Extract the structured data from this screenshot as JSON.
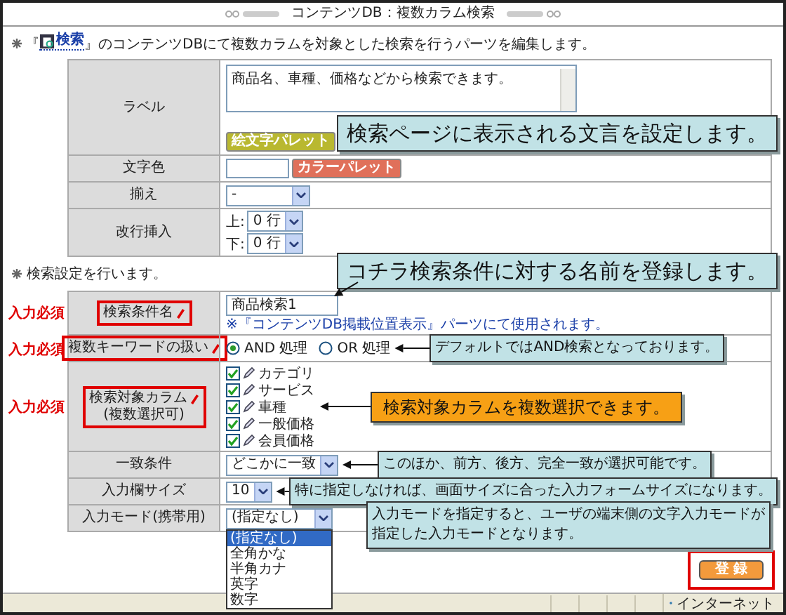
{
  "window": {
    "title": "コンテンツDB：複数カラム検索"
  },
  "intro": {
    "before": "『",
    "link": "検索",
    "after": "』のコンテンツDBにて複数カラムを対象とした検索を行うパーツを編集します。"
  },
  "display_settings": [
    {
      "kind": "textarea",
      "label": "ラベル",
      "value": "商品名、車種、価格などから検索できます。",
      "button": "絵文字パレット"
    },
    {
      "kind": "color",
      "label": "文字色",
      "button": "カラーパレット"
    },
    {
      "kind": "select",
      "label": "揃え",
      "value": "-"
    },
    {
      "kind": "line_breaks",
      "label": "改行挿入",
      "fields": [
        {
          "prefix": "上:",
          "value": "0 行"
        },
        {
          "prefix": "下:",
          "value": "0 行"
        }
      ]
    }
  ],
  "search_heading": "検索設定を行います。",
  "search_settings": [
    {
      "kind": "text",
      "label": "検索条件名",
      "required": true,
      "required_tag": "入力必須",
      "value": "商品検索1",
      "note": "※『コンテンツDB掲載位置表示』パーツにて使用されます。"
    },
    {
      "kind": "radio",
      "label": "複数キーワードの扱い",
      "required": true,
      "required_tag": "入力必須",
      "options": [
        {
          "label": "AND 処理",
          "selected": true
        },
        {
          "label": "OR 処理",
          "selected": false
        }
      ]
    },
    {
      "kind": "checkboxes",
      "label": "検索対象カラム",
      "sublabel": "(複数選択可)",
      "required": true,
      "required_tag": "入力必須",
      "options": [
        {
          "label": "カテゴリ",
          "checked": true
        },
        {
          "label": "サービス",
          "checked": true
        },
        {
          "label": "車種",
          "checked": true
        },
        {
          "label": "一般価格",
          "checked": true
        },
        {
          "label": "会員価格",
          "checked": true
        }
      ]
    },
    {
      "kind": "select",
      "label": "一致条件",
      "required": false,
      "value": "どこかに一致"
    },
    {
      "kind": "select",
      "label": "入力欄サイズ",
      "required": false,
      "value": "10"
    },
    {
      "kind": "dropdown_open",
      "label": "入力モード(携帯用)",
      "required": false,
      "value": "(指定なし)",
      "options": [
        {
          "label": "(指定なし)",
          "selected": true
        },
        {
          "label": "全角かな",
          "selected": false
        },
        {
          "label": "半角カナ",
          "selected": false
        },
        {
          "label": "英字",
          "selected": false
        },
        {
          "label": "数字",
          "selected": false
        }
      ]
    }
  ],
  "callouts": [
    {
      "kind": "large",
      "lines": [
        "検索ページに表示される文言を設定します。"
      ]
    },
    {
      "kind": "large",
      "lines": [
        "コチラ検索条件に対する名前を登録します。"
      ],
      "arrow": true
    },
    {
      "kind": "small",
      "lines": [
        "デフォルトではAND検索となっております。"
      ],
      "arrow": true
    },
    {
      "kind": "highlight",
      "lines": [
        "検索対象カラムを複数選択できます。"
      ],
      "arrow": true
    },
    {
      "kind": "small",
      "lines": [
        "このほか、前方、後方、完全一致が選択可能です。"
      ],
      "arrow": true
    },
    {
      "kind": "small",
      "lines": [
        "特に指定しなければ、画面サイズに合った入力フォームサイズになります。"
      ],
      "arrow": true
    },
    {
      "kind": "small",
      "lines": [
        "入力モードを指定すると、ユーザの端末側の文字入力モードが",
        "指定した入力モードとなります。"
      ]
    }
  ],
  "submit": "登 録",
  "status_bar": {
    "zone": "インターネット"
  }
}
